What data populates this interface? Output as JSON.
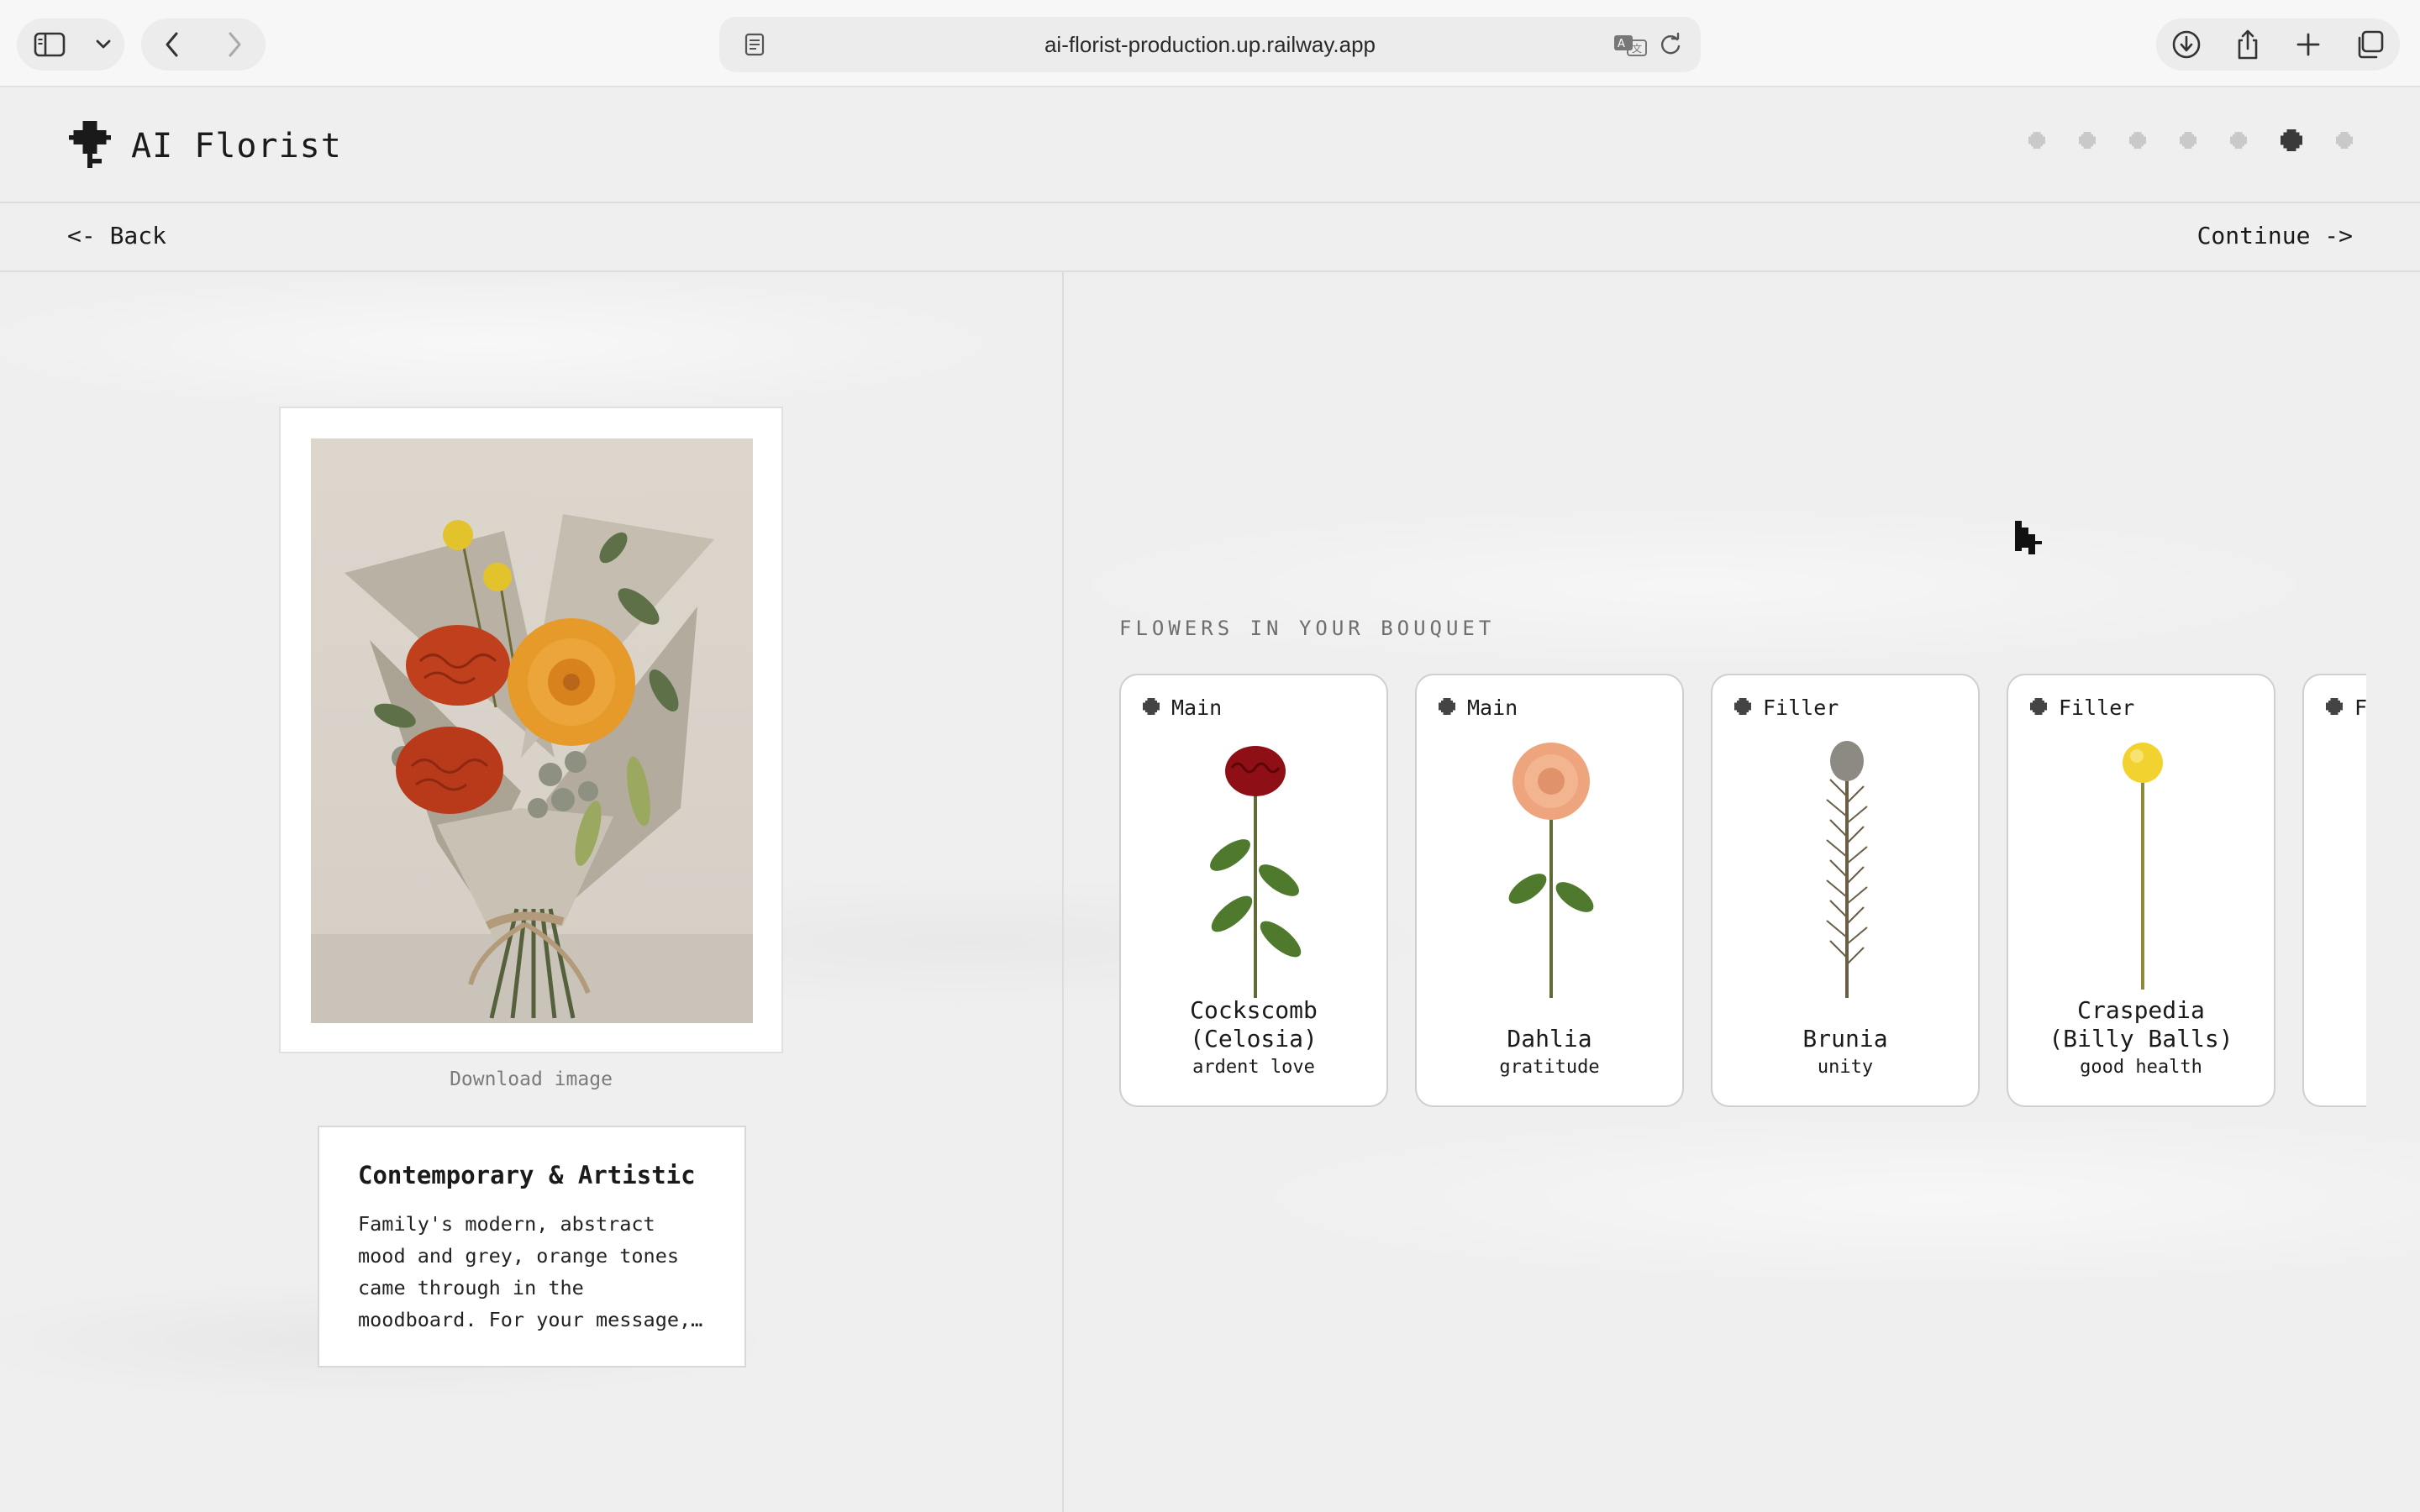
{
  "browser": {
    "url": "ai-florist-production.up.railway.app",
    "icons": [
      "sidebar-icon",
      "chevron-down-icon",
      "back-icon",
      "forward-icon",
      "reader-icon",
      "translate-icon",
      "reload-icon",
      "download-icon",
      "share-icon",
      "new-tab-icon",
      "tabs-overview-icon"
    ]
  },
  "app": {
    "title": "AI Florist",
    "steps_total": 7,
    "current_step": 6
  },
  "nav": {
    "back_label": "<- Back",
    "continue_label": "Continue ->"
  },
  "bouquet": {
    "download_label": "Download image",
    "style_title": "Contemporary & Artistic",
    "style_description": "Family's modern, abstract mood and grey, orange tones came through in the moodboard. For your message, the arrangement balances bold texture with soft neutral wrapping."
  },
  "flowers": {
    "section_label": "FLOWERS IN YOUR BOUQUET",
    "items": [
      {
        "tag": "Main",
        "name": "Cockscomb\n(Celosia)",
        "meaning": "ardent love",
        "color": "#8e1016"
      },
      {
        "tag": "Main",
        "name": "Dahlia",
        "meaning": "gratitude",
        "color": "#eea47c"
      },
      {
        "tag": "Filler",
        "name": "Brunia",
        "meaning": "unity",
        "color": "#8d8a84"
      },
      {
        "tag": "Filler",
        "name": "Craspedia\n(Billy Balls)",
        "meaning": "good health",
        "color": "#f2d22e"
      },
      {
        "tag": "F",
        "name": "",
        "meaning": "",
        "color": "#4d6b3a"
      }
    ]
  },
  "colors": {
    "accent": "#1a1a1a",
    "step_inactive": "#c9c9c9",
    "step_active": "#3a3a3a"
  }
}
